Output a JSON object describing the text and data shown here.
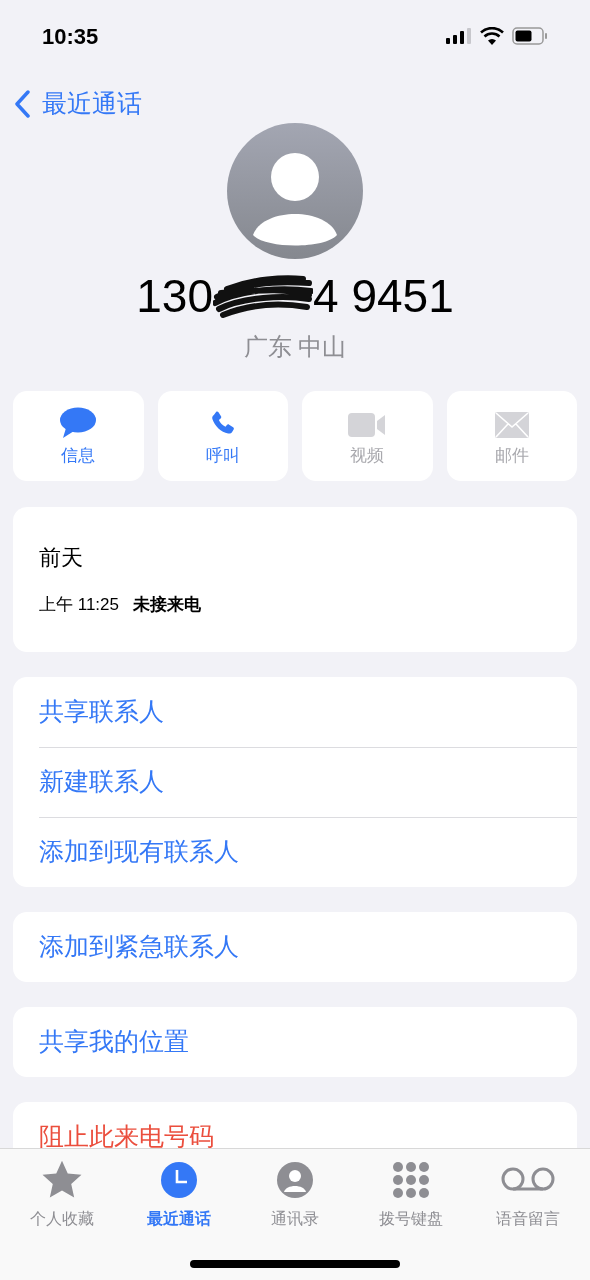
{
  "status_bar": {
    "time": "10:35"
  },
  "nav": {
    "back_label": "最近通话"
  },
  "contact": {
    "number_start": "130",
    "number_end": "4 9451",
    "location": "广东 中山"
  },
  "actions": [
    {
      "kind": "message",
      "label": "信息",
      "disabled": false
    },
    {
      "kind": "call",
      "label": "呼叫",
      "disabled": false
    },
    {
      "kind": "video",
      "label": "视频",
      "disabled": true
    },
    {
      "kind": "mail",
      "label": "邮件",
      "disabled": true
    }
  ],
  "recent_call": {
    "date": "前天",
    "time": "上午 11:25",
    "status": "未接来电"
  },
  "menu_groups": [
    [
      {
        "label": "共享联系人",
        "kind": "action"
      },
      {
        "label": "新建联系人",
        "kind": "action"
      },
      {
        "label": "添加到现有联系人",
        "kind": "action"
      }
    ],
    [
      {
        "label": "添加到紧急联系人",
        "kind": "action"
      }
    ],
    [
      {
        "label": "共享我的位置",
        "kind": "action"
      }
    ],
    [
      {
        "label": "阻止此来电号码",
        "kind": "destructive"
      }
    ]
  ],
  "tab_bar": [
    {
      "kind": "favorites",
      "label": "个人收藏",
      "selected": false
    },
    {
      "kind": "recents",
      "label": "最近通话",
      "selected": true
    },
    {
      "kind": "contacts",
      "label": "通讯录",
      "selected": false
    },
    {
      "kind": "keypad",
      "label": "拨号键盘",
      "selected": false
    },
    {
      "kind": "voicemail",
      "label": "语音留言",
      "selected": false
    }
  ]
}
